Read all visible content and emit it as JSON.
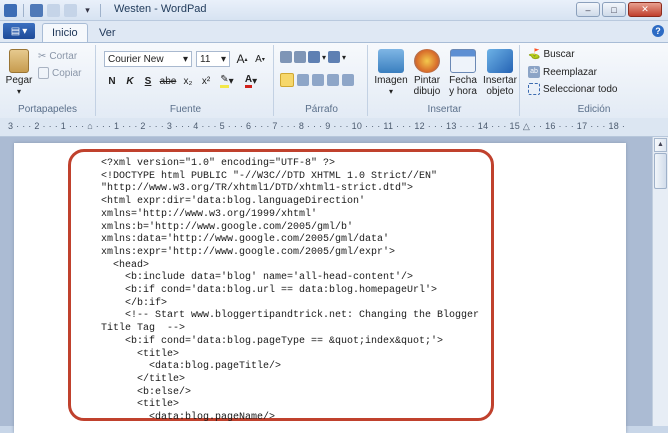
{
  "window": {
    "title": "Westen - WordPad"
  },
  "tabs": {
    "home": "Inicio",
    "view": "Ver"
  },
  "ribbon": {
    "clipboard": {
      "label": "Portapapeles",
      "paste": "Pegar",
      "cut": "Cortar",
      "copy": "Copiar"
    },
    "font": {
      "label": "Fuente",
      "family": "Courier New",
      "size": "11",
      "bold": "N",
      "italic": "K",
      "underline": "S",
      "strike": "abe",
      "subscript": "x₂",
      "superscript": "x²",
      "grow": "A",
      "shrink": "A"
    },
    "paragraph": {
      "label": "Párrafo"
    },
    "insert": {
      "label": "Insertar",
      "image": "Imagen",
      "paint_drawing": "Pintar dibujo",
      "datetime": "Fecha y hora",
      "insert_object": "Insertar objeto"
    },
    "editing": {
      "label": "Edición",
      "find": "Buscar",
      "replace": "Reemplazar",
      "select_all": "Seleccionar todo"
    }
  },
  "ruler": {
    "text": "3 · · · 2 · · · 1 · · · ⌂ · · · 1 · · · 2 · · · 3 · · · 4 · · · 5 · · · 6 · · · 7 · · · 8 · · · 9 · · · 10 · · · 11 · · · 12 · · · 13 · · · 14 · · · 15 △ · · 16 · · · 17 · · · 18 ·"
  },
  "document": {
    "lines": [
      "<?xml version=\"1.0\" encoding=\"UTF-8\" ?>",
      "<!DOCTYPE html PUBLIC \"-//W3C//DTD XHTML 1.0 Strict//EN\"",
      "\"http://www.w3.org/TR/xhtml1/DTD/xhtml1-strict.dtd\">",
      "<html expr:dir='data:blog.languageDirection'",
      "xmlns='http://www.w3.org/1999/xhtml'",
      "xmlns:b='http://www.google.com/2005/gml/b'",
      "xmlns:data='http://www.google.com/2005/gml/data'",
      "xmlns:expr='http://www.google.com/2005/gml/expr'>",
      "  <head>",
      "    <b:include data='blog' name='all-head-content'/>",
      "    <b:if cond='data:blog.url == data:blog.homepageUrl'>",
      "    </b:if>",
      "    <!-- Start www.bloggertipandtrick.net: Changing the Blogger",
      "Title Tag  -->",
      "    <b:if cond='data:blog.pageType == &quot;index&quot;'>",
      "      <title>",
      "        <data:blog.pageTitle/>",
      "      </title>",
      "      <b:else/>",
      "      <title>",
      "        <data:blog.pageName/>"
    ]
  }
}
